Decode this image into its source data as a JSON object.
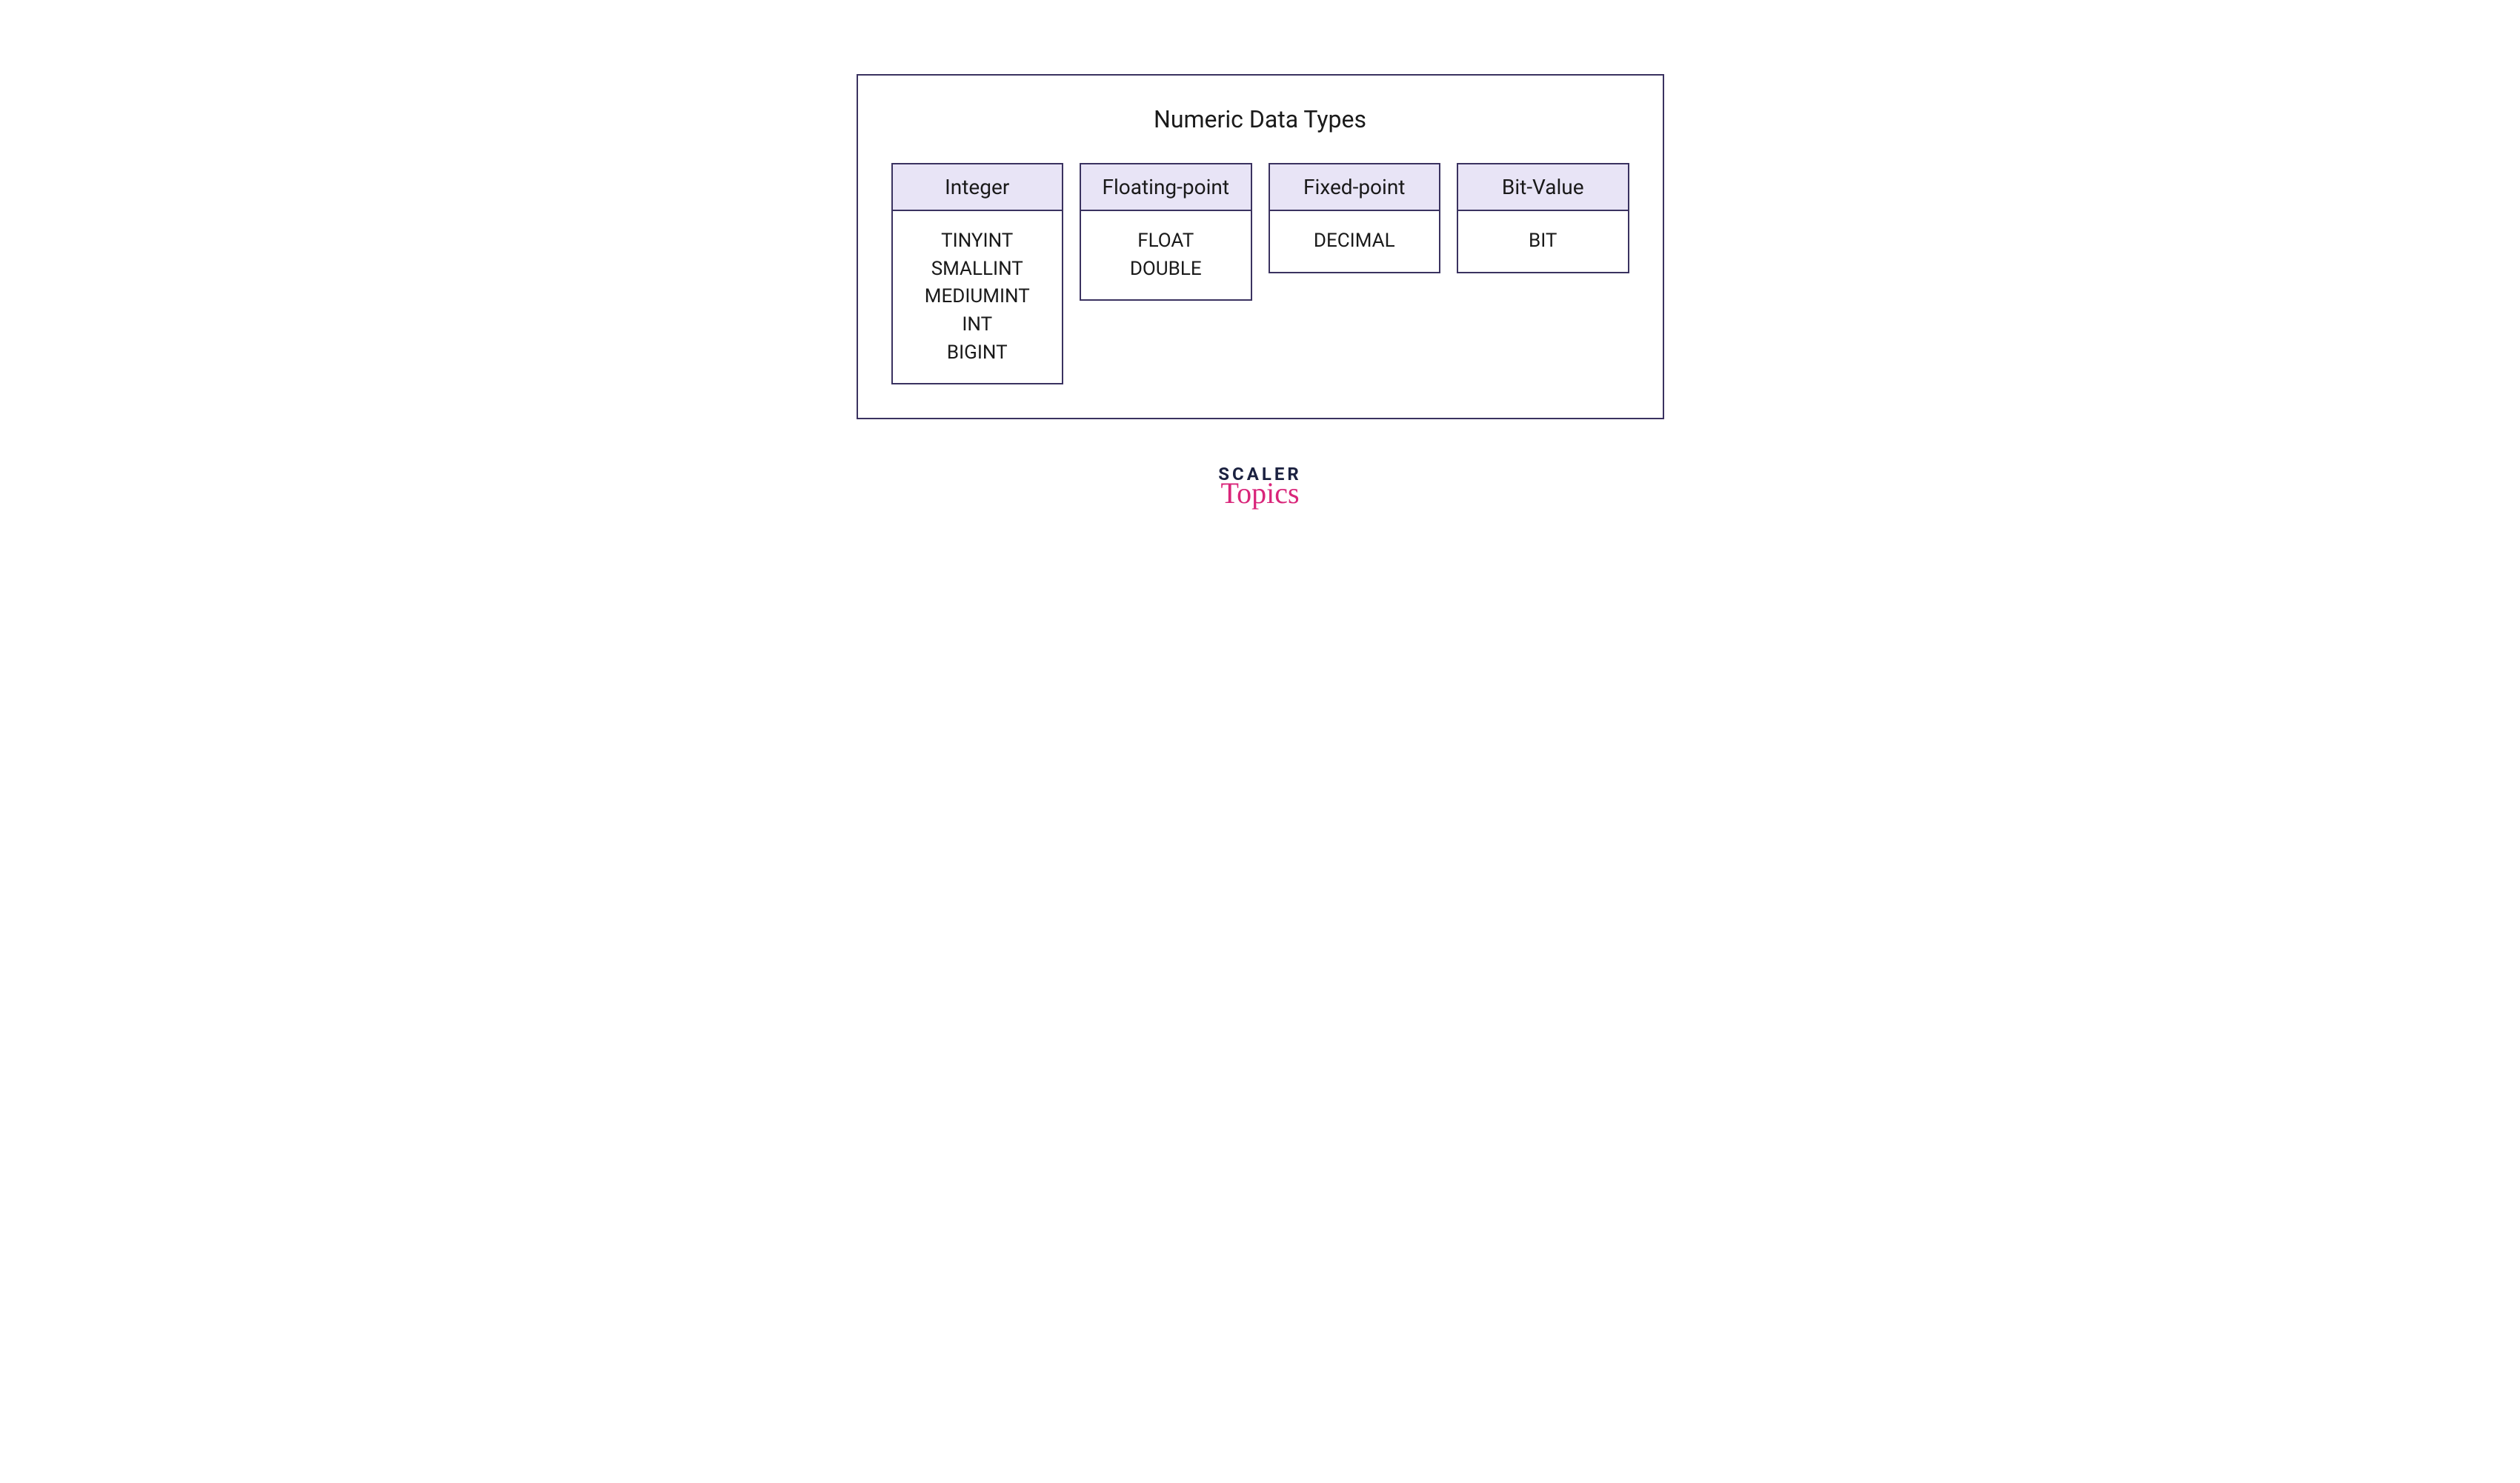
{
  "title": "Numeric Data Types",
  "categories": [
    {
      "name": "Integer",
      "items": [
        "TINYINT",
        "SMALLINT",
        "MEDIUMINT",
        "INT",
        "BIGINT"
      ]
    },
    {
      "name": "Floating-point",
      "items": [
        "FLOAT",
        "DOUBLE"
      ]
    },
    {
      "name": "Fixed-point",
      "items": [
        "DECIMAL"
      ]
    },
    {
      "name": "Bit-Value",
      "items": [
        "BIT"
      ]
    }
  ],
  "logo": {
    "top": "SCALER",
    "bottom": "Topics"
  },
  "colors": {
    "border": "#3a3260",
    "headerBg": "#e8e4f6",
    "logoDark": "#1b2140",
    "logoPink": "#d9257a"
  }
}
